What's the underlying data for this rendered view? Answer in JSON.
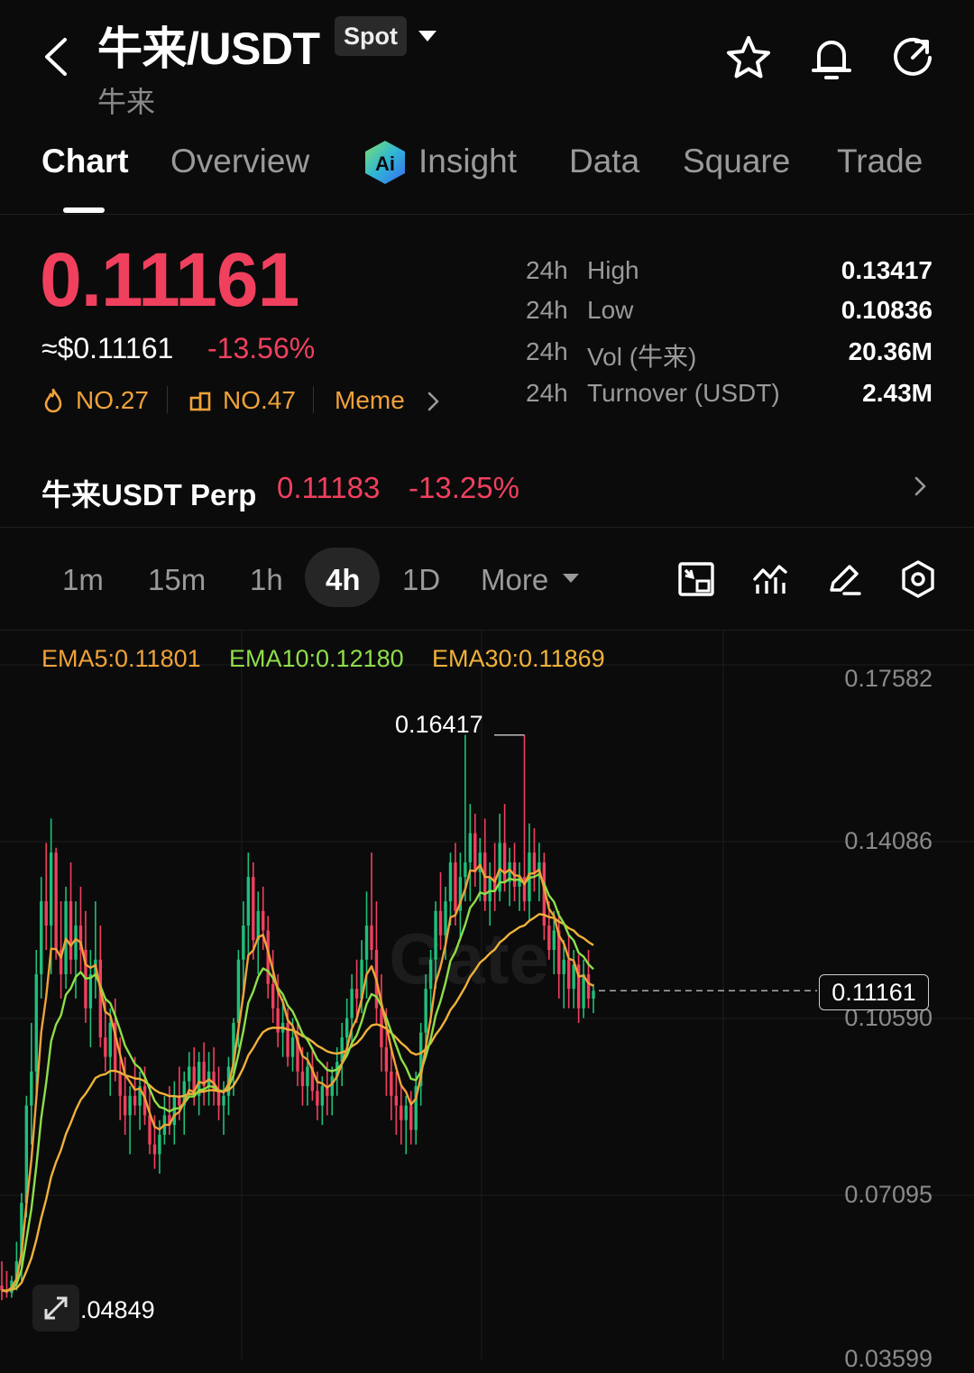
{
  "header": {
    "pair": "牛来/USDT",
    "market_badge": "Spot",
    "subtitle": "牛来",
    "icons": [
      "back-icon",
      "chevron-down-icon",
      "star-icon",
      "bell-icon",
      "refresh-icon"
    ]
  },
  "tabs": [
    {
      "label": "Chart",
      "active": true
    },
    {
      "label": "Overview"
    },
    {
      "label": "Insight",
      "icon": "ai-icon"
    },
    {
      "label": "Data"
    },
    {
      "label": "Square"
    },
    {
      "label": "Trade"
    }
  ],
  "ticker": {
    "price": "0.11161",
    "approx_usd": "≈$0.11161",
    "change": "-13.56%",
    "rank1": "NO.27",
    "rank2": "NO.47",
    "category": "Meme",
    "stats": [
      {
        "period": "24h",
        "label": "High",
        "value": "0.13417"
      },
      {
        "period": "24h",
        "label": "Low",
        "value": "0.10836"
      },
      {
        "period": "24h",
        "label": "Vol (牛来)",
        "value": "20.36M"
      },
      {
        "period": "24h",
        "label": "Turnover (USDT)",
        "value": "2.43M"
      }
    ]
  },
  "perp": {
    "name": "牛来USDT Perp",
    "price": "0.11183",
    "change": "-13.25%"
  },
  "timeframes": {
    "items": [
      "1m",
      "15m",
      "1h",
      "4h",
      "1D"
    ],
    "selected": "4h",
    "more_label": "More"
  },
  "colors": {
    "down": "#f0405e",
    "up": "#1fbf7a",
    "ema5": "#f0a23a",
    "ema10": "#8ede4a",
    "ema30": "#f0b23a",
    "accent": "#f0a23a"
  },
  "chart_data": {
    "type": "candlestick",
    "timeframe": "4h",
    "indicators": [
      {
        "name": "EMA5",
        "value": "0.11801",
        "label": "EMA5:0.11801"
      },
      {
        "name": "EMA10",
        "value": "0.12180",
        "label": "EMA10:0.12180"
      },
      {
        "name": "EMA30",
        "value": "0.11869",
        "label": "EMA30:0.11869"
      }
    ],
    "y_ticks": [
      "0.17582",
      "0.14086",
      "0.10590",
      "0.07095",
      "0.03599"
    ],
    "ylim": [
      0.03599,
      0.17582
    ],
    "max_marker": "0.16417",
    "min_marker": "0.04849",
    "last_price": "0.11161",
    "watermark": "Gate",
    "candles": [
      {
        "o": 0.051,
        "h": 0.056,
        "l": 0.048,
        "c": 0.05
      },
      {
        "o": 0.05,
        "h": 0.054,
        "l": 0.0485,
        "c": 0.0495
      },
      {
        "o": 0.0495,
        "h": 0.053,
        "l": 0.0485,
        "c": 0.052
      },
      {
        "o": 0.052,
        "h": 0.06,
        "l": 0.05,
        "c": 0.056
      },
      {
        "o": 0.056,
        "h": 0.07,
        "l": 0.052,
        "c": 0.068
      },
      {
        "o": 0.068,
        "h": 0.09,
        "l": 0.065,
        "c": 0.088
      },
      {
        "o": 0.088,
        "h": 0.105,
        "l": 0.08,
        "c": 0.095
      },
      {
        "o": 0.095,
        "h": 0.12,
        "l": 0.09,
        "c": 0.115
      },
      {
        "o": 0.115,
        "h": 0.135,
        "l": 0.11,
        "c": 0.13
      },
      {
        "o": 0.13,
        "h": 0.142,
        "l": 0.12,
        "c": 0.125
      },
      {
        "o": 0.125,
        "h": 0.147,
        "l": 0.115,
        "c": 0.14
      },
      {
        "o": 0.14,
        "h": 0.141,
        "l": 0.118,
        "c": 0.12
      },
      {
        "o": 0.12,
        "h": 0.13,
        "l": 0.11,
        "c": 0.115
      },
      {
        "o": 0.115,
        "h": 0.133,
        "l": 0.112,
        "c": 0.13
      },
      {
        "o": 0.13,
        "h": 0.138,
        "l": 0.115,
        "c": 0.118
      },
      {
        "o": 0.118,
        "h": 0.13,
        "l": 0.11,
        "c": 0.125
      },
      {
        "o": 0.125,
        "h": 0.133,
        "l": 0.115,
        "c": 0.12
      },
      {
        "o": 0.12,
        "h": 0.128,
        "l": 0.105,
        "c": 0.108
      },
      {
        "o": 0.108,
        "h": 0.12,
        "l": 0.1,
        "c": 0.115
      },
      {
        "o": 0.115,
        "h": 0.13,
        "l": 0.11,
        "c": 0.118
      },
      {
        "o": 0.118,
        "h": 0.125,
        "l": 0.1,
        "c": 0.102
      },
      {
        "o": 0.102,
        "h": 0.11,
        "l": 0.095,
        "c": 0.098
      },
      {
        "o": 0.098,
        "h": 0.108,
        "l": 0.09,
        "c": 0.105
      },
      {
        "o": 0.105,
        "h": 0.11,
        "l": 0.093,
        "c": 0.095
      },
      {
        "o": 0.095,
        "h": 0.102,
        "l": 0.085,
        "c": 0.09
      },
      {
        "o": 0.09,
        "h": 0.098,
        "l": 0.082,
        "c": 0.086
      },
      {
        "o": 0.086,
        "h": 0.092,
        "l": 0.078,
        "c": 0.09
      },
      {
        "o": 0.09,
        "h": 0.098,
        "l": 0.086,
        "c": 0.088
      },
      {
        "o": 0.088,
        "h": 0.095,
        "l": 0.083,
        "c": 0.092
      },
      {
        "o": 0.092,
        "h": 0.096,
        "l": 0.084,
        "c": 0.086
      },
      {
        "o": 0.086,
        "h": 0.092,
        "l": 0.078,
        "c": 0.08
      },
      {
        "o": 0.08,
        "h": 0.086,
        "l": 0.075,
        "c": 0.078
      },
      {
        "o": 0.078,
        "h": 0.085,
        "l": 0.074,
        "c": 0.082
      },
      {
        "o": 0.082,
        "h": 0.09,
        "l": 0.08,
        "c": 0.086
      },
      {
        "o": 0.086,
        "h": 0.092,
        "l": 0.082,
        "c": 0.084
      },
      {
        "o": 0.084,
        "h": 0.093,
        "l": 0.08,
        "c": 0.09
      },
      {
        "o": 0.09,
        "h": 0.096,
        "l": 0.085,
        "c": 0.088
      },
      {
        "o": 0.088,
        "h": 0.095,
        "l": 0.082,
        "c": 0.093
      },
      {
        "o": 0.093,
        "h": 0.099,
        "l": 0.09,
        "c": 0.096
      },
      {
        "o": 0.096,
        "h": 0.1,
        "l": 0.088,
        "c": 0.09
      },
      {
        "o": 0.09,
        "h": 0.099,
        "l": 0.086,
        "c": 0.097
      },
      {
        "o": 0.097,
        "h": 0.101,
        "l": 0.088,
        "c": 0.092
      },
      {
        "o": 0.092,
        "h": 0.099,
        "l": 0.088,
        "c": 0.095
      },
      {
        "o": 0.095,
        "h": 0.1,
        "l": 0.088,
        "c": 0.091
      },
      {
        "o": 0.091,
        "h": 0.096,
        "l": 0.085,
        "c": 0.088
      },
      {
        "o": 0.088,
        "h": 0.093,
        "l": 0.082,
        "c": 0.09
      },
      {
        "o": 0.09,
        "h": 0.098,
        "l": 0.086,
        "c": 0.096
      },
      {
        "o": 0.096,
        "h": 0.106,
        "l": 0.09,
        "c": 0.105
      },
      {
        "o": 0.105,
        "h": 0.12,
        "l": 0.1,
        "c": 0.118
      },
      {
        "o": 0.118,
        "h": 0.13,
        "l": 0.11,
        "c": 0.125
      },
      {
        "o": 0.125,
        "h": 0.14,
        "l": 0.118,
        "c": 0.135
      },
      {
        "o": 0.135,
        "h": 0.138,
        "l": 0.118,
        "c": 0.122
      },
      {
        "o": 0.122,
        "h": 0.132,
        "l": 0.115,
        "c": 0.128
      },
      {
        "o": 0.128,
        "h": 0.133,
        "l": 0.12,
        "c": 0.124
      },
      {
        "o": 0.124,
        "h": 0.127,
        "l": 0.11,
        "c": 0.113
      },
      {
        "o": 0.113,
        "h": 0.12,
        "l": 0.105,
        "c": 0.108
      },
      {
        "o": 0.108,
        "h": 0.115,
        "l": 0.1,
        "c": 0.103
      },
      {
        "o": 0.103,
        "h": 0.11,
        "l": 0.098,
        "c": 0.105
      },
      {
        "o": 0.105,
        "h": 0.108,
        "l": 0.096,
        "c": 0.098
      },
      {
        "o": 0.098,
        "h": 0.106,
        "l": 0.095,
        "c": 0.102
      },
      {
        "o": 0.102,
        "h": 0.105,
        "l": 0.092,
        "c": 0.095
      },
      {
        "o": 0.095,
        "h": 0.1,
        "l": 0.088,
        "c": 0.092
      },
      {
        "o": 0.092,
        "h": 0.099,
        "l": 0.088,
        "c": 0.096
      },
      {
        "o": 0.096,
        "h": 0.1,
        "l": 0.089,
        "c": 0.091
      },
      {
        "o": 0.091,
        "h": 0.095,
        "l": 0.085,
        "c": 0.088
      },
      {
        "o": 0.088,
        "h": 0.094,
        "l": 0.084,
        "c": 0.092
      },
      {
        "o": 0.092,
        "h": 0.097,
        "l": 0.086,
        "c": 0.09
      },
      {
        "o": 0.09,
        "h": 0.096,
        "l": 0.086,
        "c": 0.094
      },
      {
        "o": 0.094,
        "h": 0.1,
        "l": 0.09,
        "c": 0.097
      },
      {
        "o": 0.097,
        "h": 0.105,
        "l": 0.092,
        "c": 0.102
      },
      {
        "o": 0.102,
        "h": 0.11,
        "l": 0.098,
        "c": 0.106
      },
      {
        "o": 0.106,
        "h": 0.115,
        "l": 0.1,
        "c": 0.112
      },
      {
        "o": 0.112,
        "h": 0.118,
        "l": 0.105,
        "c": 0.11
      },
      {
        "o": 0.11,
        "h": 0.122,
        "l": 0.107,
        "c": 0.118
      },
      {
        "o": 0.118,
        "h": 0.132,
        "l": 0.11,
        "c": 0.125
      },
      {
        "o": 0.125,
        "h": 0.14,
        "l": 0.118,
        "c": 0.12
      },
      {
        "o": 0.12,
        "h": 0.13,
        "l": 0.105,
        "c": 0.108
      },
      {
        "o": 0.108,
        "h": 0.115,
        "l": 0.095,
        "c": 0.1
      },
      {
        "o": 0.1,
        "h": 0.108,
        "l": 0.09,
        "c": 0.095
      },
      {
        "o": 0.095,
        "h": 0.1,
        "l": 0.085,
        "c": 0.09
      },
      {
        "o": 0.09,
        "h": 0.095,
        "l": 0.082,
        "c": 0.088
      },
      {
        "o": 0.088,
        "h": 0.092,
        "l": 0.08,
        "c": 0.085
      },
      {
        "o": 0.085,
        "h": 0.09,
        "l": 0.078,
        "c": 0.088
      },
      {
        "o": 0.088,
        "h": 0.091,
        "l": 0.08,
        "c": 0.083
      },
      {
        "o": 0.083,
        "h": 0.095,
        "l": 0.08,
        "c": 0.092
      },
      {
        "o": 0.092,
        "h": 0.105,
        "l": 0.088,
        "c": 0.103
      },
      {
        "o": 0.103,
        "h": 0.115,
        "l": 0.1,
        "c": 0.112
      },
      {
        "o": 0.112,
        "h": 0.12,
        "l": 0.105,
        "c": 0.118
      },
      {
        "o": 0.118,
        "h": 0.13,
        "l": 0.112,
        "c": 0.128
      },
      {
        "o": 0.128,
        "h": 0.136,
        "l": 0.12,
        "c": 0.123
      },
      {
        "o": 0.123,
        "h": 0.133,
        "l": 0.118,
        "c": 0.13
      },
      {
        "o": 0.13,
        "h": 0.14,
        "l": 0.125,
        "c": 0.138
      },
      {
        "o": 0.138,
        "h": 0.142,
        "l": 0.125,
        "c": 0.128
      },
      {
        "o": 0.128,
        "h": 0.14,
        "l": 0.122,
        "c": 0.135
      },
      {
        "o": 0.135,
        "h": 0.1642,
        "l": 0.13,
        "c": 0.138
      },
      {
        "o": 0.138,
        "h": 0.15,
        "l": 0.13,
        "c": 0.144
      },
      {
        "o": 0.144,
        "h": 0.148,
        "l": 0.133,
        "c": 0.136
      },
      {
        "o": 0.136,
        "h": 0.143,
        "l": 0.13,
        "c": 0.14
      },
      {
        "o": 0.14,
        "h": 0.147,
        "l": 0.128,
        "c": 0.13
      },
      {
        "o": 0.13,
        "h": 0.138,
        "l": 0.125,
        "c": 0.135
      },
      {
        "o": 0.135,
        "h": 0.142,
        "l": 0.128,
        "c": 0.132
      },
      {
        "o": 0.132,
        "h": 0.148,
        "l": 0.13,
        "c": 0.142
      },
      {
        "o": 0.142,
        "h": 0.15,
        "l": 0.132,
        "c": 0.134
      },
      {
        "o": 0.134,
        "h": 0.141,
        "l": 0.129,
        "c": 0.138
      },
      {
        "o": 0.138,
        "h": 0.142,
        "l": 0.13,
        "c": 0.133
      },
      {
        "o": 0.133,
        "h": 0.138,
        "l": 0.128,
        "c": 0.135
      },
      {
        "o": 0.135,
        "h": 0.1642,
        "l": 0.128,
        "c": 0.13
      },
      {
        "o": 0.13,
        "h": 0.146,
        "l": 0.126,
        "c": 0.14
      },
      {
        "o": 0.14,
        "h": 0.145,
        "l": 0.132,
        "c": 0.136
      },
      {
        "o": 0.136,
        "h": 0.142,
        "l": 0.13,
        "c": 0.138
      },
      {
        "o": 0.138,
        "h": 0.14,
        "l": 0.122,
        "c": 0.125
      },
      {
        "o": 0.125,
        "h": 0.13,
        "l": 0.118,
        "c": 0.12
      },
      {
        "o": 0.12,
        "h": 0.128,
        "l": 0.115,
        "c": 0.124
      },
      {
        "o": 0.124,
        "h": 0.128,
        "l": 0.11,
        "c": 0.115
      },
      {
        "o": 0.115,
        "h": 0.122,
        "l": 0.108,
        "c": 0.118
      },
      {
        "o": 0.118,
        "h": 0.123,
        "l": 0.108,
        "c": 0.112
      },
      {
        "o": 0.112,
        "h": 0.12,
        "l": 0.108,
        "c": 0.117
      },
      {
        "o": 0.117,
        "h": 0.119,
        "l": 0.105,
        "c": 0.108
      },
      {
        "o": 0.108,
        "h": 0.118,
        "l": 0.106,
        "c": 0.115
      },
      {
        "o": 0.115,
        "h": 0.12,
        "l": 0.108,
        "c": 0.11
      },
      {
        "o": 0.11,
        "h": 0.113,
        "l": 0.107,
        "c": 0.1116
      }
    ]
  }
}
